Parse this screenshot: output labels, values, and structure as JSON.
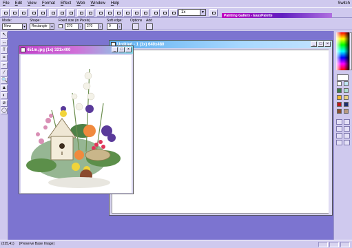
{
  "menu": {
    "items": [
      "File",
      "Edit",
      "View",
      "Format",
      "Effect",
      "Web",
      "Window",
      "Help"
    ],
    "switch_label": "Switch"
  },
  "toolbar": {
    "zoom_value": "1x"
  },
  "palette": {
    "title": "Painting Gallery - EasyPalette"
  },
  "options": {
    "mode_label": "Mode:",
    "mode_value": "New",
    "shape_label": "Shape:",
    "shape_value": "Rectangle",
    "fixed_size_label": "Fixed size (in Pixels)",
    "width_value": "270",
    "height_value": "270",
    "soft_edge_label": "Soft edge:",
    "soft_edge_value": "0",
    "options_label": "Options",
    "add_label": "Add"
  },
  "windows": {
    "untitled_title": "Untitled - 1 (1x) 640x480",
    "photo_title": "451m.jpg (1x) 321x400"
  },
  "tools": [
    "↖",
    "↔",
    "T",
    "⌗",
    "⌐",
    "∕",
    "🔍",
    "▲",
    "◐",
    "⌀",
    "◯"
  ],
  "status": {
    "coords": "(225,41)",
    "message": "[Preserve Base Image]"
  },
  "colors": {
    "workspace": "#7c74d0",
    "chrome": "#cfc9ee",
    "untitled_title_start": "#5fb0f0",
    "photo_title_start": "#c040c8",
    "palette_title_start": "#c000c0"
  }
}
